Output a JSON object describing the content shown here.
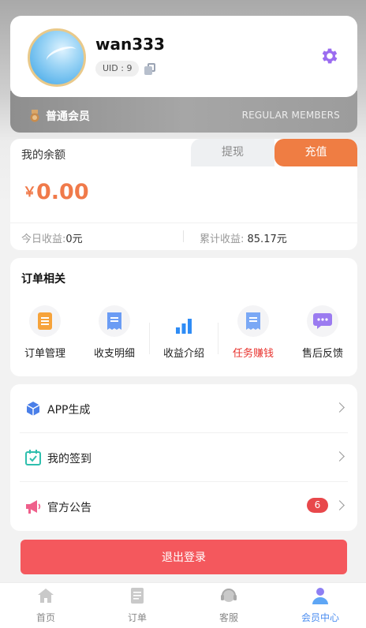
{
  "profile": {
    "username": "wan333",
    "uid_label": "UID : 9"
  },
  "membership": {
    "level": "普通会员",
    "level_en": "REGULAR MEMBERS"
  },
  "balance": {
    "title": "我的余额",
    "withdraw_label": "提现",
    "recharge_label": "充值",
    "currency": "￥",
    "amount": "0.00",
    "today_label": "今日收益:",
    "today_value": "0元",
    "total_label": "累计收益: ",
    "total_value": "85.17元"
  },
  "orders": {
    "title": "订单相关",
    "items": [
      {
        "label": "订单管理",
        "icon": "order-list-icon"
      },
      {
        "label": "收支明细",
        "icon": "receipt-icon"
      },
      {
        "label": "收益介绍",
        "icon": "bar-chart-icon"
      },
      {
        "label": "任务赚钱",
        "icon": "task-receipt-icon"
      },
      {
        "label": "售后反馈",
        "icon": "chat-bubble-icon"
      }
    ]
  },
  "menu": {
    "items": [
      {
        "label": "APP生成",
        "icon": "cube-icon"
      },
      {
        "label": "我的签到",
        "icon": "calendar-check-icon"
      },
      {
        "label": "官方公告",
        "icon": "megaphone-icon",
        "badge": "6"
      }
    ]
  },
  "logout_label": "退出登录",
  "tabbar": {
    "tabs": [
      {
        "label": "首页",
        "icon": "home-icon"
      },
      {
        "label": "订单",
        "icon": "document-icon"
      },
      {
        "label": "客服",
        "icon": "headset-icon"
      },
      {
        "label": "会员中心",
        "icon": "user-icon",
        "active": true
      }
    ]
  },
  "colors": {
    "accent_orange": "#ef7d43",
    "logout_red": "#f4585d",
    "badge_red": "#e8484b",
    "tab_active": "#4b8df0",
    "gear": "#9b6cf0"
  }
}
